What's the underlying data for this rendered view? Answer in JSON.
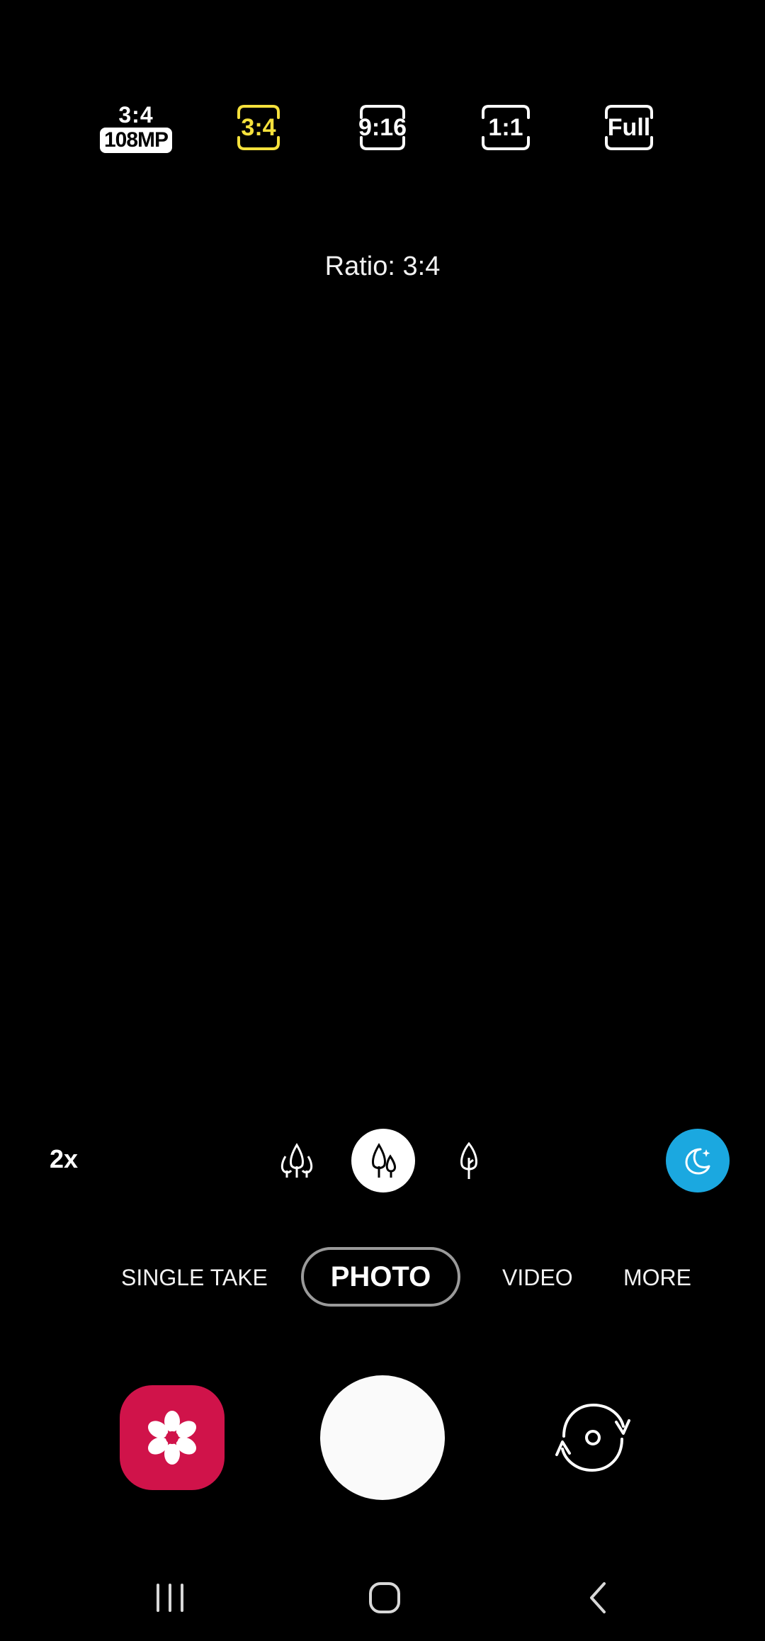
{
  "ratio_options": [
    {
      "label": "3:4",
      "badge": "108MP"
    },
    {
      "label": "3:4",
      "selected": true
    },
    {
      "label": "9:16"
    },
    {
      "label": "1:1"
    },
    {
      "label": "Full"
    }
  ],
  "ratio_caption": "Ratio: 3:4",
  "zoom": {
    "label": "2x"
  },
  "lenses": [
    {
      "icon": "ultra-wide-trees-icon"
    },
    {
      "icon": "wide-trees-icon",
      "selected": true
    },
    {
      "icon": "telephoto-tree-icon"
    }
  ],
  "night_mode": {
    "icon": "moon-icon",
    "color": "#1ba8e0"
  },
  "modes": [
    "SINGLE TAKE",
    "PHOTO",
    "VIDEO",
    "MORE"
  ],
  "selected_mode": "PHOTO",
  "colors": {
    "selected_ratio": "#f5e13c",
    "gallery": "#d0134a",
    "accent": "#1ba8e0"
  },
  "controls": {
    "gallery_icon": "flower-gallery-icon",
    "shutter": "shutter-button",
    "switch_icon": "switch-camera-icon"
  },
  "nav": [
    "recent-apps-icon",
    "home-icon",
    "back-icon"
  ]
}
